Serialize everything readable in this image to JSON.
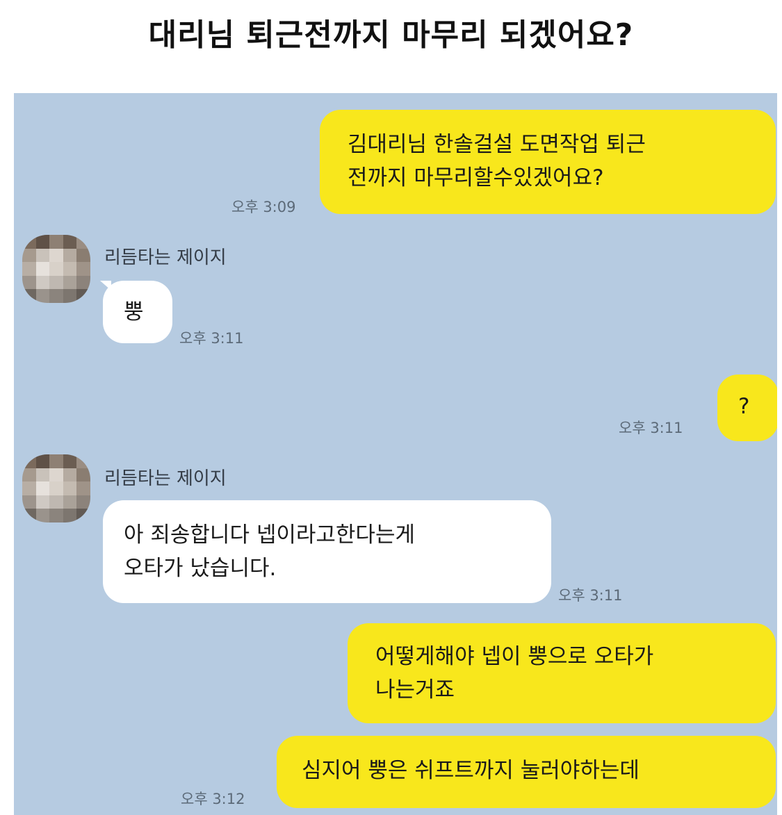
{
  "headline": "대리님 퇴근전까지 마무리 되겠어요?",
  "colors": {
    "chat_background": "#b6cbe1",
    "my_bubble": "#f8e71c",
    "their_bubble": "#ffffff"
  },
  "messages": [
    {
      "from": "me",
      "text": "김대리님 한솔걸설 도면작업 퇴근\n전까지 마무리할수있겠어요?",
      "time": "오후 3:09"
    },
    {
      "from": "other",
      "sender": "리듬타는 제이지",
      "avatar": "pixelated-profile-photo",
      "text": "뿡",
      "time": "오후 3:11"
    },
    {
      "from": "me",
      "text": "?",
      "time": "오후 3:11"
    },
    {
      "from": "other",
      "sender": "리듬타는 제이지",
      "avatar": "pixelated-profile-photo",
      "text": "아 죄송합니다 넵이라고한다는게\n오타가 났습니다.",
      "time": "오후 3:11"
    },
    {
      "from": "me",
      "text": "어떻게해야 넵이 뿡으로 오타가\n나는거죠",
      "time": ""
    },
    {
      "from": "me",
      "text": "심지어 뿡은 쉬프트까지 눌러야하는데",
      "time": "오후 3:12"
    }
  ]
}
